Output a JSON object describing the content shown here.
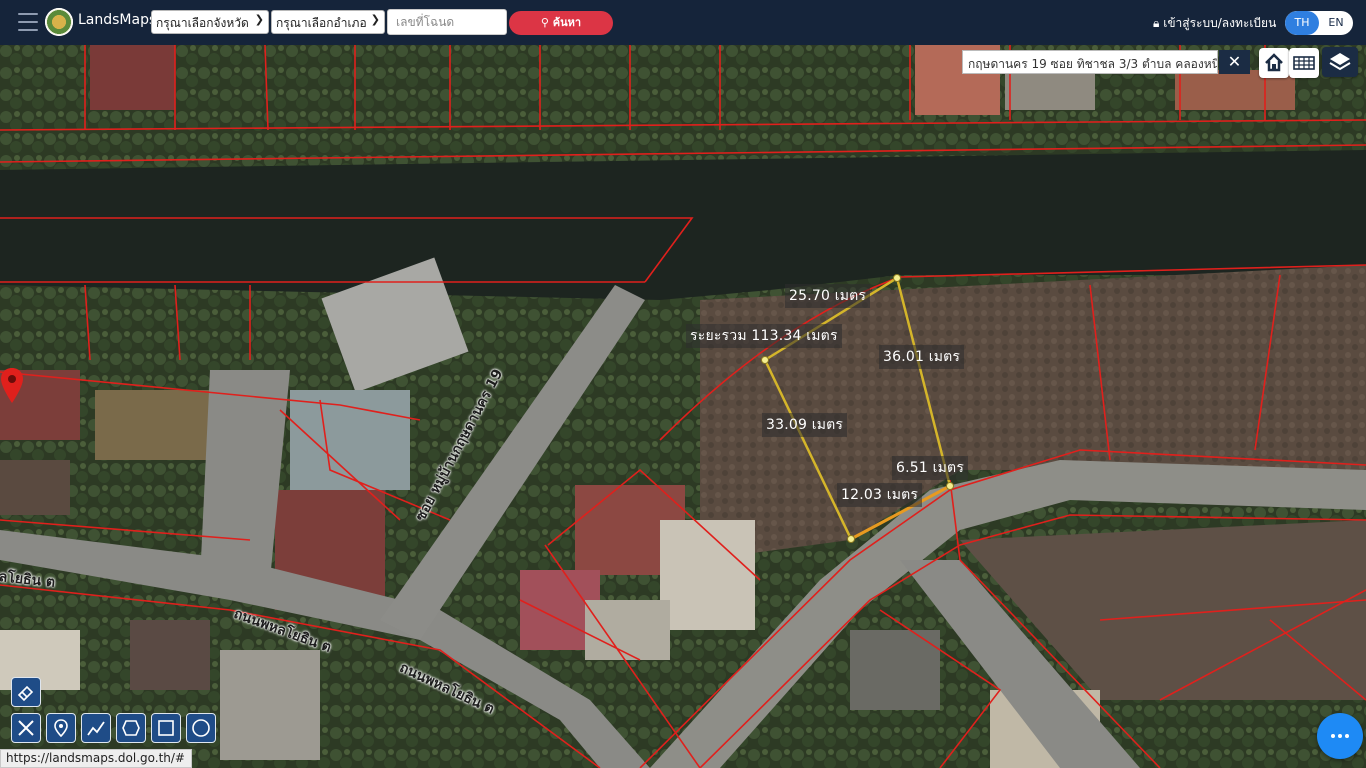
{
  "header": {
    "brand": "LandsMaps",
    "province_select": "กรุณาเลือกจังหวัด",
    "district_select": "กรุณาเลือกอำเภอ",
    "deed_placeholder": "เลขที่โฉนด",
    "search_label": "ค้นหา",
    "login_label": "เข้าสู่ระบบ/ลงทะเบียน",
    "lang_th": "TH",
    "lang_en": "EN"
  },
  "map": {
    "address": "กฤษดานคร 19 ซอย ทิชาชล 3/3 ตำบล คลองหนึ่ง",
    "measurements": {
      "side_top": "25.70 เมตร",
      "total": "ระยะรวม 113.34 เมตร",
      "side_right": "36.01 เมตร",
      "side_left": "33.09 เมตร",
      "side_short": "6.51 เมตร",
      "side_bottom": "12.03 เมตร"
    },
    "roads": {
      "soi": "ซอย หมู่บ้านกฤษดานคร 19",
      "road_1": "ถนนพหลโยธิน ต",
      "road_2": "ถนนพหลโยธิน ต",
      "road_left": "ลโยธิน ต"
    },
    "icons": {
      "home": "home-icon",
      "grid": "grid-icon",
      "layers": "layers-icon",
      "pin": "map-pin-icon"
    },
    "colors": {
      "parcel_line": "#e0201c",
      "measure_line": "#d4b52a",
      "pin": "#e0201c"
    }
  },
  "status_url": "https://landsmaps.dol.go.th/#"
}
